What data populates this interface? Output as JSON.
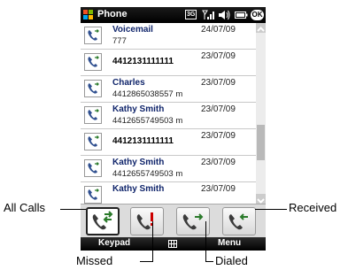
{
  "titlebar": {
    "title": "Phone",
    "network": "3G",
    "ok": "OK"
  },
  "calls": [
    {
      "name": "Voicemail",
      "number": "777",
      "date": "24/07/09"
    },
    {
      "name": "",
      "number": "4412131111111",
      "date": "23/07/09"
    },
    {
      "name": "Charles",
      "number": "4412865038557 m",
      "date": "23/07/09"
    },
    {
      "name": "Kathy Smith",
      "number": "4412655749503 m",
      "date": "23/07/09"
    },
    {
      "name": "",
      "number": "4412131111111",
      "date": "23/07/09"
    },
    {
      "name": "Kathy Smith",
      "number": "4412655749503 m",
      "date": "23/07/09"
    },
    {
      "name": "Kathy Smith",
      "number": "",
      "date": "23/07/09"
    }
  ],
  "tabs": [
    {
      "id": "all",
      "icon": "all-calls-icon"
    },
    {
      "id": "missed",
      "icon": "missed-calls-icon"
    },
    {
      "id": "dialed",
      "icon": "dialed-calls-icon"
    },
    {
      "id": "received",
      "icon": "received-calls-icon"
    }
  ],
  "softkeys": {
    "left": "Keypad",
    "right": "Menu"
  },
  "callouts": {
    "all": "All Calls",
    "received": "Received",
    "missed": "Missed",
    "dialed": "Dialed"
  }
}
